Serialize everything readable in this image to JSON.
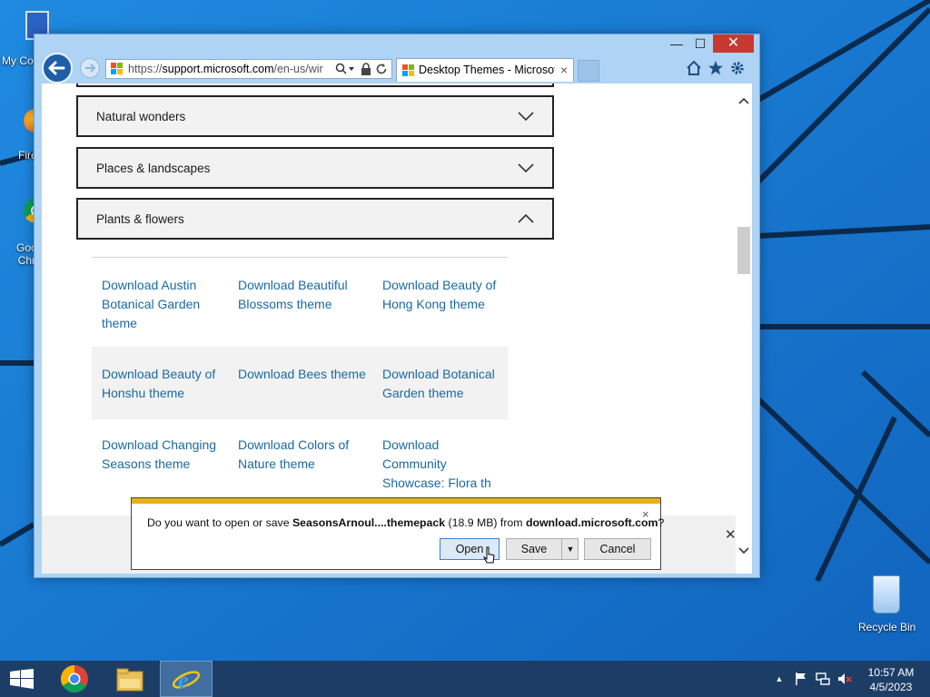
{
  "desktop": {
    "icons": [
      {
        "label": "My Co"
      },
      {
        "label": "Fire"
      },
      {
        "label": "Goo\nChr"
      },
      {
        "label": "Recycle Bin"
      }
    ]
  },
  "browser": {
    "address": {
      "prefix": "https://",
      "domain": "support.microsoft.com",
      "path": "/en-us/wir"
    },
    "tab": {
      "title": "Desktop Themes - Microsof...",
      "close": "×"
    },
    "caption": {
      "minimize": "—",
      "maximize": "☐",
      "close": "✕"
    }
  },
  "page": {
    "accordions": [
      {
        "label": "Natural wonders",
        "state": "collapsed"
      },
      {
        "label": "Places & landscapes",
        "state": "collapsed"
      },
      {
        "label": "Plants & flowers",
        "state": "expanded"
      }
    ],
    "theme_rows": [
      {
        "shaded": false,
        "cells": [
          "Download Austin Botanical Garden theme",
          "Download Beautiful Blossoms theme",
          "Download Beauty of Hong Kong theme"
        ]
      },
      {
        "shaded": true,
        "cells": [
          "Download Beauty of Honshu theme",
          "Download Bees theme",
          "Download Botanical Garden theme"
        ]
      },
      {
        "shaded": false,
        "cells": [
          "Download Changing Seasons theme",
          "Download Colors of Nature theme",
          "Download Community Showcase: Flora th"
        ]
      }
    ]
  },
  "download": {
    "prefix": "Do you want to open or save ",
    "filename": "SeasonsArnoul....themepack",
    "size": " (18.9 MB) from ",
    "source": "download.microsoft.com",
    "suffix": "?",
    "open_label": "Open",
    "save_label": "Save",
    "cancel_label": "Cancel",
    "close": "×"
  },
  "notification_close": "✕",
  "taskbar": {
    "time": "10:57 AM",
    "date": "4/5/2023"
  },
  "colors": {
    "desktop": "#1979d2",
    "link": "#1a6aa1",
    "accent_bar": "#e7b11a",
    "close_button": "#c7392f"
  }
}
